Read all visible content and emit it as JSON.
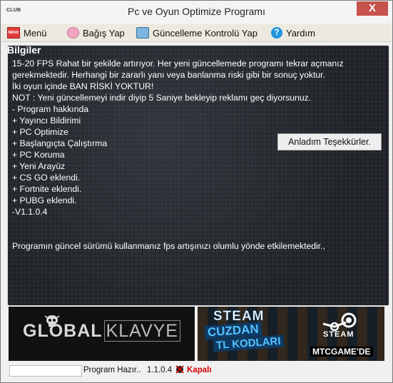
{
  "window": {
    "app_icon_text": "CLUB",
    "title": "Pc ve Oyun Optimize Programı",
    "close_glyph": "X"
  },
  "menu": [
    {
      "label": "Menü",
      "icon": "menu-icon"
    },
    {
      "label": "Bağış Yap",
      "icon": "piggy-bank-icon"
    },
    {
      "label": "Güncelleme Kontrolü Yap",
      "icon": "update-icon"
    },
    {
      "label": "Yardım",
      "icon": "help-icon"
    }
  ],
  "info": {
    "group_label": "Bilgiler",
    "lines": [
      "  15-20 FPS  Rahat bir şekilde artırıyor. Her yeni güncellemede programı tekrar açmanız",
      "gerekmektedir. Herhangi bir zararlı yanı veya banlanma riski gibi bir sonuç yoktur.",
      "  İki oyun içinde BAN RİSKİ YOKTUR!",
      "  NOT : Yeni güncellemeyi indir diyip 5 Saniye bekleyip reklamı geç diyorsunuz.",
      " - Program hakkında",
      "    + Yayıncı Bildirimi",
      "    + PC Optimize",
      "    + Başlangıçta Çalıştırma",
      "    + PC Koruma",
      "    + Yeni Arayüz",
      "    + CS GO eklendi.",
      "    + Fortnite eklendi.",
      "    + PUBG eklendi.",
      " -V1.1.0.4"
    ],
    "footer": "Programın güncel sürümü kullanmanız fps artışınızı olumlu yönde etkilemektedir.,",
    "ack_button": "Anladım Teşekkürler."
  },
  "banners": {
    "left": {
      "text_global": "GL",
      "text_o": "O",
      "text_bal": "BAL",
      "text_klavye": "KLAVYE"
    },
    "right": {
      "line1": "STEAM",
      "line2": "CUZDAN",
      "line3": "TL KODLARI",
      "brand": "STEAM",
      "site": "MTCGAME'DE"
    }
  },
  "status": {
    "progress": 0,
    "state": "Program Hazır..",
    "version": "1.1.0.4",
    "power": "Kapalı"
  },
  "colors": {
    "accent_red": "#d40000",
    "info_bg": "#1e2227"
  }
}
